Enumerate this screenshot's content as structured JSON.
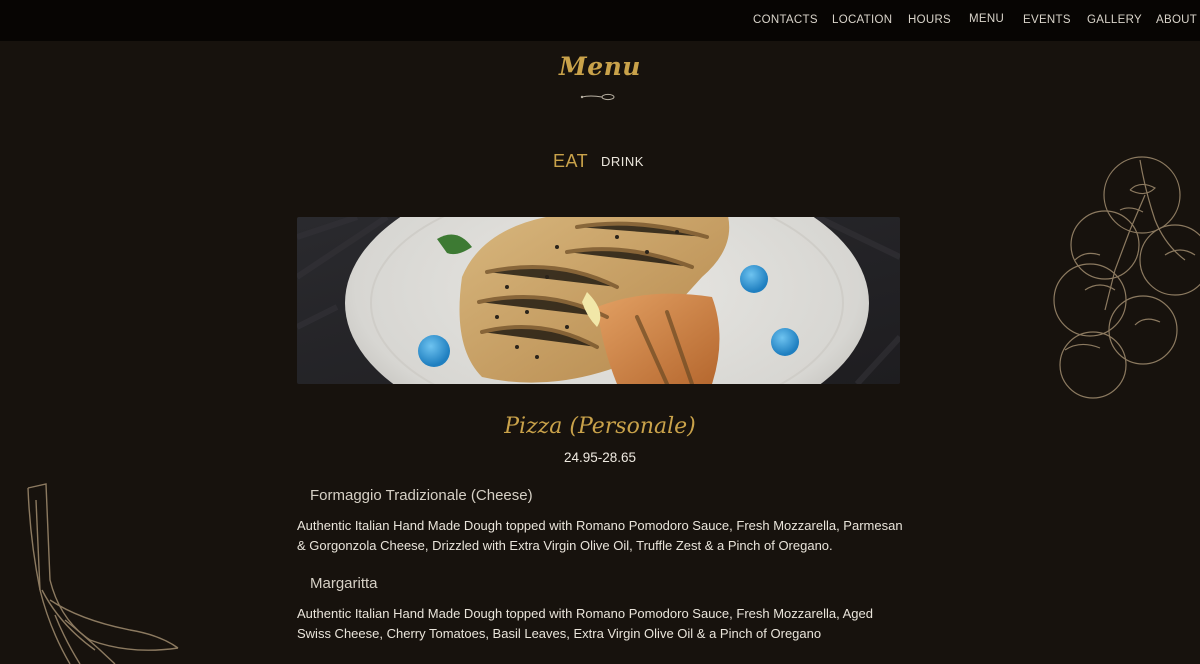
{
  "nav": {
    "items": [
      "CONTACTS",
      "LOCATION",
      "HOURS",
      "MENU",
      "EVENTS",
      "GALLERY",
      "ABOUT"
    ]
  },
  "page": {
    "title": "Menu"
  },
  "tabs": {
    "eat": "EAT",
    "drink": "DRINK",
    "active": "EAT"
  },
  "section": {
    "title": "Pizza (Personale)",
    "price": "24.95-28.65",
    "items": [
      {
        "name": "Formaggio Tradizionale (Cheese)",
        "description": "Authentic Italian Hand Made Dough topped with Romano Pomodoro Sauce, Fresh Mozzarella, Parmesan & Gorgonzola Cheese, Drizzled with Extra Virgin Olive Oil, Truffle Zest & a Pinch of Oregano."
      },
      {
        "name": "Margaritta",
        "description": "Authentic Italian Hand Made Dough topped with Romano Pomodoro Sauce, Fresh Mozzarella, Aged Swiss Cheese, Cherry Tomatoes, Basil Leaves, Extra Virgin Olive Oil & a Pinch of Oregano"
      }
    ]
  },
  "colors": {
    "background": "#17120d",
    "topbar": "#070503",
    "accent_gold": "#c9a24a",
    "sketch_lines": "#8c7a60"
  },
  "icons": {
    "divider": "spoon-divider-icon",
    "decor_right": "cherry-tomato-vine-illustration",
    "decor_left": "garlic-illustration"
  }
}
